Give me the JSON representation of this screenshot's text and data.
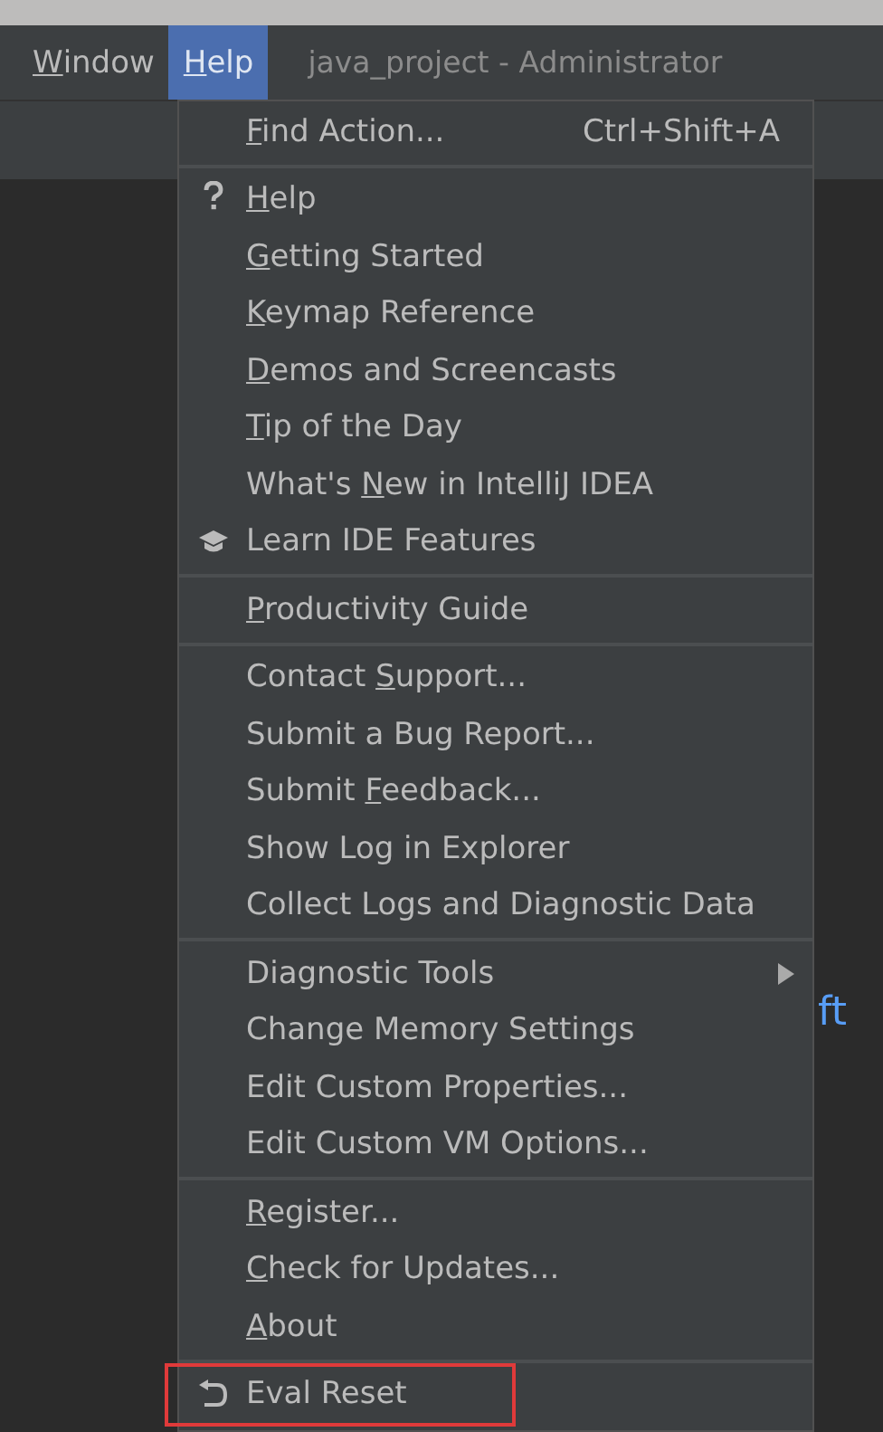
{
  "menubar": {
    "items": [
      {
        "key": "W",
        "post": "indow",
        "selected": false
      },
      {
        "key": "H",
        "post": "elp",
        "selected": true
      }
    ],
    "title": "java_project - Administrator"
  },
  "background": {
    "right_text": "ft"
  },
  "menu": {
    "groups": [
      [
        {
          "key": "F",
          "post": "ind Action...",
          "shortcut": "Ctrl+Shift+A"
        }
      ],
      [
        {
          "kind": "question",
          "key": "H",
          "post": "elp"
        },
        {
          "key": "G",
          "post": "etting Started"
        },
        {
          "key": "K",
          "post": "eymap Reference"
        },
        {
          "key": "D",
          "post": "emos and Screencasts"
        },
        {
          "key": "T",
          "post": "ip of the Day"
        },
        {
          "pre": "What's ",
          "key": "N",
          "post": "ew in IntelliJ IDEA"
        },
        {
          "kind": "cap",
          "pre": "Learn IDE Features"
        }
      ],
      [
        {
          "key": "P",
          "post": "roductivity Guide"
        }
      ],
      [
        {
          "pre": "Contact ",
          "key": "S",
          "post": "upport..."
        },
        {
          "pre": "Submit a Bug Report..."
        },
        {
          "pre": "Submit ",
          "key": "F",
          "post": "eedback..."
        },
        {
          "pre": "Show Log in Explorer"
        },
        {
          "pre": "Collect Logs and Diagnostic Data"
        }
      ],
      [
        {
          "pre": "Diagnostic Tools",
          "submenu": true
        },
        {
          "pre": "Change Memory Settings"
        },
        {
          "pre": "Edit Custom Properties..."
        },
        {
          "pre": "Edit Custom VM Options..."
        }
      ],
      [
        {
          "key": "R",
          "post": "egister..."
        },
        {
          "key": "C",
          "post": "heck for Updates..."
        },
        {
          "key": "A",
          "post": "bout"
        }
      ],
      [
        {
          "kind": "undo",
          "pre": "Eval Reset",
          "highlighted": true
        }
      ]
    ]
  }
}
